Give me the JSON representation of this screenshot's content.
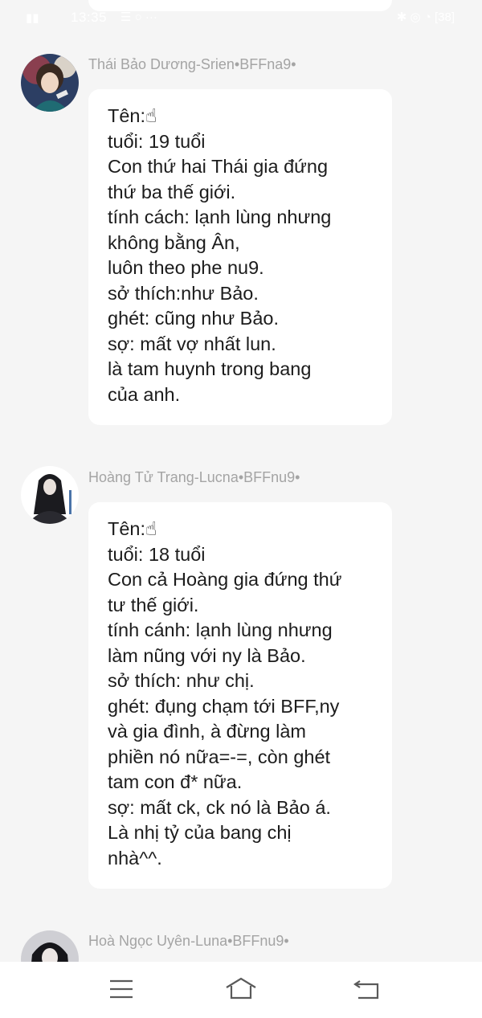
{
  "status_bar": {
    "time": "13:35",
    "signal_label": "▮▮",
    "extra_icons": "☰ ○ ···",
    "right_icons": "✱ ◎ ◔ [38]"
  },
  "messages": [
    {
      "sender": "Thái Bảo Dương-Srien•BFFna9•",
      "lines": [
        "Tên:☝",
        "tuổi: 19 tuổi",
        "Con thứ hai Thái gia  đứng",
        "thứ ba thế giới.",
        "tính cách: lạnh lùng nhưng",
        "không bằng Ân,",
        "luôn theo phe nu9.",
        "sở thích:như Bảo.",
        "ghét: cũng như Bảo.",
        "sợ: mất vợ nhất lun.",
        "là tam huynh trong bang",
        "của anh."
      ]
    },
    {
      "sender": "Hoàng Tử Trang-Lucna•BFFnu9•",
      "lines": [
        "Tên:☝",
        "tuổi: 18 tuổi",
        "Con cả Hoàng gia đứng thứ",
        "tư thế giới.",
        "tính cánh:  lạnh lùng nhưng",
        "làm nũng với ny là  Bảo.",
        "sở thích: như chị.",
        "ghét: đụng chạm tới BFF,ny",
        "và gia đình, à đừng làm",
        "phiền nó nữa=-=, còn ghét",
        "tam con đ* nữa.",
        "sợ: mất ck, ck nó là Bảo á.",
        "Là nhị tỷ của bang chị",
        "nhà^^."
      ]
    },
    {
      "sender": "Hoà Ngọc Uyên-Luna•BFFnu9•",
      "lines": []
    }
  ],
  "nav": {
    "menu_icon": "menu-icon",
    "home_icon": "home-icon",
    "back_icon": "back-icon"
  },
  "colors": {
    "background": "#f5f5f5",
    "bubble": "#ffffff",
    "sender_text": "#a4a4a4",
    "message_text": "#1c1c1c",
    "nav_icon": "#5a5a5a"
  }
}
